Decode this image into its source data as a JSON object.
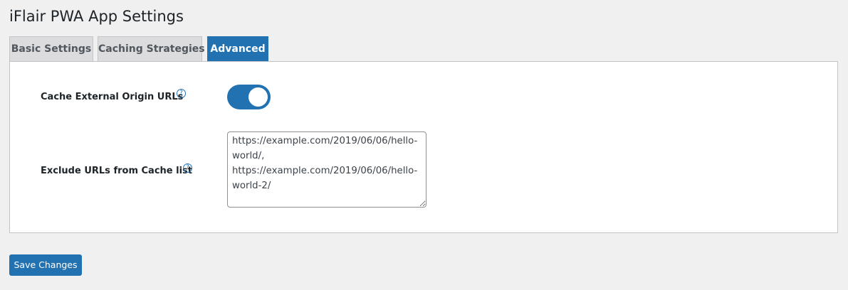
{
  "page": {
    "title": "iFlair PWA App Settings"
  },
  "tabs": [
    {
      "label": "Basic Settings",
      "active": false
    },
    {
      "label": "Caching Strategies",
      "active": false
    },
    {
      "label": "Advanced",
      "active": true
    }
  ],
  "settings": {
    "cache_external": {
      "label": "Cache External Origin URLs",
      "help_icon": "question-circle-icon",
      "enabled": true
    },
    "exclude_urls": {
      "label": "Exclude URLs from Cache list",
      "help_icon": "question-circle-icon",
      "value": "https://example.com/2019/06/06/hello-world/,\nhttps://example.com/2019/06/06/hello-world-2/"
    }
  },
  "actions": {
    "save_label": "Save Changes"
  },
  "colors": {
    "accent": "#2271b1",
    "background": "#f0f0f1",
    "panel": "#ffffff",
    "inactive_tab": "#dcdcde"
  }
}
